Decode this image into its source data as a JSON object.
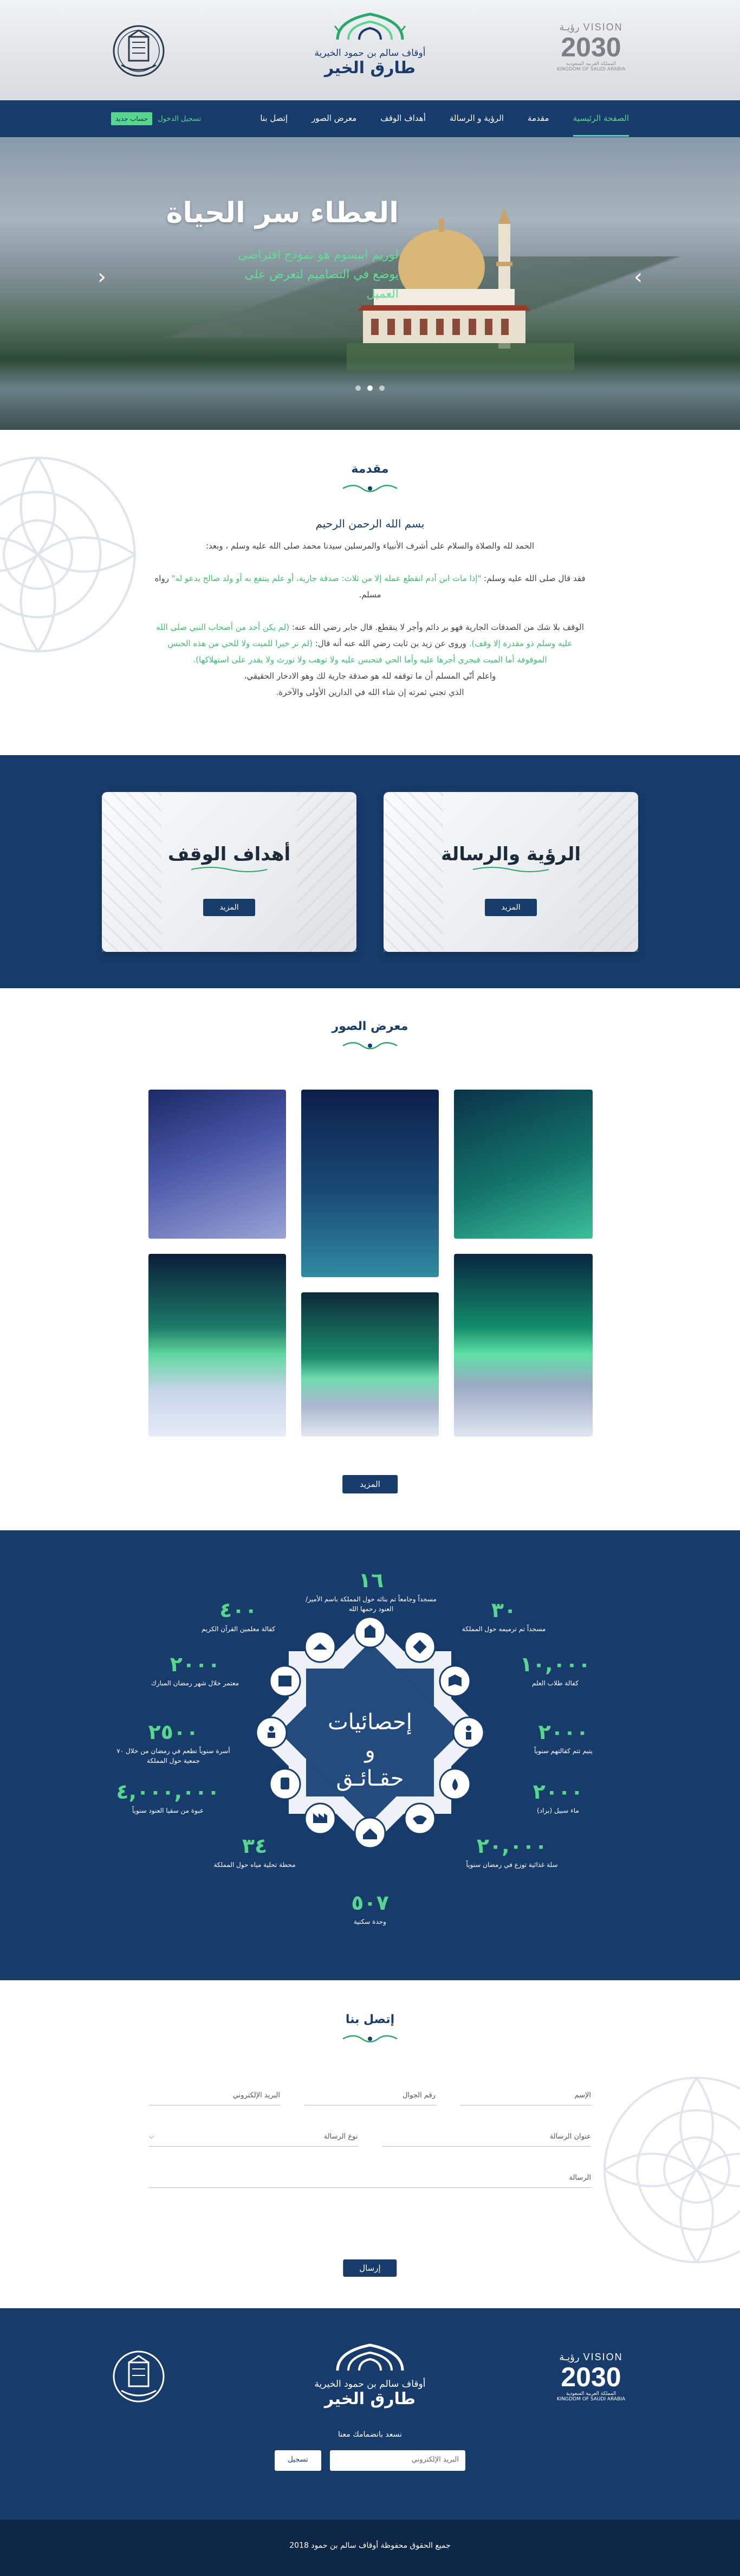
{
  "header": {
    "brand_sub": "أوقاف سالم بن حمود الخيرية",
    "brand_main": "طارق الخير",
    "vision_word": "VISION",
    "vision_arabic": "رؤيـة",
    "vision_year": "2030",
    "vision_caption": "المملكة العربية السعودية",
    "vision_caption_en": "KINGDOM OF SAUDI ARABIA"
  },
  "nav": {
    "items": [
      {
        "label": "الصفحة الرئيسية",
        "active": true
      },
      {
        "label": "مقدمة"
      },
      {
        "label": "الرؤية و الرسالة"
      },
      {
        "label": "أهداف الوقف"
      },
      {
        "label": "معرض الصور"
      },
      {
        "label": "إتصل بنا"
      }
    ],
    "login": "تسجيل الدخول",
    "signup": "حساب جديد"
  },
  "hero": {
    "title": "العطاء سر الحياة",
    "text": "لوريم ايبسوم هو نموذج افتراضي يوضع في التصاميم لتعرض على العميل",
    "prev": "‹",
    "next": "›"
  },
  "intro": {
    "title": "مقدمة",
    "basmala": "بسم الله الرحمن الرحيم",
    "p1": "الحمد لله والصلاة والسلام على أشرف الأنبياء والمرسلين سيدنا محمد صلى الله عليه وسلم ، وبعد:",
    "p2_a": "فقد قال صلى الله عليه وسلم: ",
    "p2_g": "\"إذا مات ابن آدم انقطع عمله إلا من ثلاث: صدقة جارية، أو علم ينتفع به أو ولد صالح يدعو له\"",
    "p2_b": " رواه مسلم.",
    "p3_a": "الوقف بلا شك من الصدقات الجارية فهو بر دائم وأجر لا ينقطع. قال جابر رضي الله عنه: ",
    "p3_g": "(لم يكن أحد من أصحاب النبي صلى الله عليه وسلم ذو مقدرة إلا وقف).",
    "p3_b": " وروى عن زيد بن ثابت رضي الله عنه أنه قال: ",
    "p3_g2": "(لم نر خيرا للميت ولا للحي من هذه الحبس الموقوفة أما الميت فيجري أجرها عليه وأما الحي فتحبس عليه ولا توهب ولا تورث ولا يقدر على استهلاكها).",
    "p4": "واعلم أنّي المسلم أن ما توقفه لله هو صدقة جارية لك وهو الادخار الحقيقي،",
    "p5": "الذي تجني ثمرته إن شاء الله في الدارين الأولى والآخرة."
  },
  "cards": [
    {
      "title": "الرؤية والرسالة",
      "button": "المزيد"
    },
    {
      "title": "أهداف الوقف",
      "button": "المزيد"
    }
  ],
  "gallery": {
    "title": "معرض الصور",
    "button": "المزيد"
  },
  "stats": {
    "center_line1": "إحصائيات",
    "center_line2": "و",
    "center_line3": "حقـائـق",
    "items": [
      {
        "num": "١٦",
        "lbl": "مسجداً وجامعاً تم بنائه حول المملكة باسم الأمير/ العنود رحمها الله"
      },
      {
        "num": "٣٠",
        "lbl": "مسجداً تم ترميمه حول المملكة"
      },
      {
        "num": "٤٠٠",
        "lbl": "كفالة معلمين القرآن الكريم"
      },
      {
        "num": "١٠,٠٠٠",
        "lbl": "كفالة طلاب العلم"
      },
      {
        "num": "٢٠٠٠",
        "lbl": "معتمر خلال شهر رمضان المبارك"
      },
      {
        "num": "٢٠٠٠",
        "lbl": "يتيم تتم كفالتهم سنوياً"
      },
      {
        "num": "٢٥٠٠",
        "lbl": "أسرة سنوياً تطعم في رمضان من خلال ٧٠ جمعية حول المملكة"
      },
      {
        "num": "٢٠٠٠",
        "lbl": "ماء سبيل (براد)"
      },
      {
        "num": "٤,٠٠٠,٠٠٠",
        "lbl": "عبوة من سقيا العنود سنوياً"
      },
      {
        "num": "٢٠,٠٠٠",
        "lbl": "سلة غذائية توزع في رمضان سنوياً"
      },
      {
        "num": "٣٤",
        "lbl": "محطة تحلية مياه حول المملكة"
      },
      {
        "num": "٥٠٧",
        "lbl": "وحدة سكنية"
      }
    ]
  },
  "contact": {
    "title": "إتصل بنا",
    "name": "الإسم",
    "phone": "رقم الجوال",
    "email": "البريد الإلكتروني",
    "subject": "عنوان الرسالة",
    "type": "نوع الرسالة",
    "message": "الرسالة",
    "send": "إرسال"
  },
  "footer": {
    "newsletter_label": "نسعد بانضمامك معنا",
    "email_placeholder": "البريد الإلكتروني",
    "subscribe": "تسجيل",
    "copyright": "جميع الحقوق محفوظة أوقاف سالم بن حمود 2018"
  },
  "colors": {
    "navy": "#173b6b",
    "green": "#58d68d",
    "dark": "#0e2746"
  }
}
